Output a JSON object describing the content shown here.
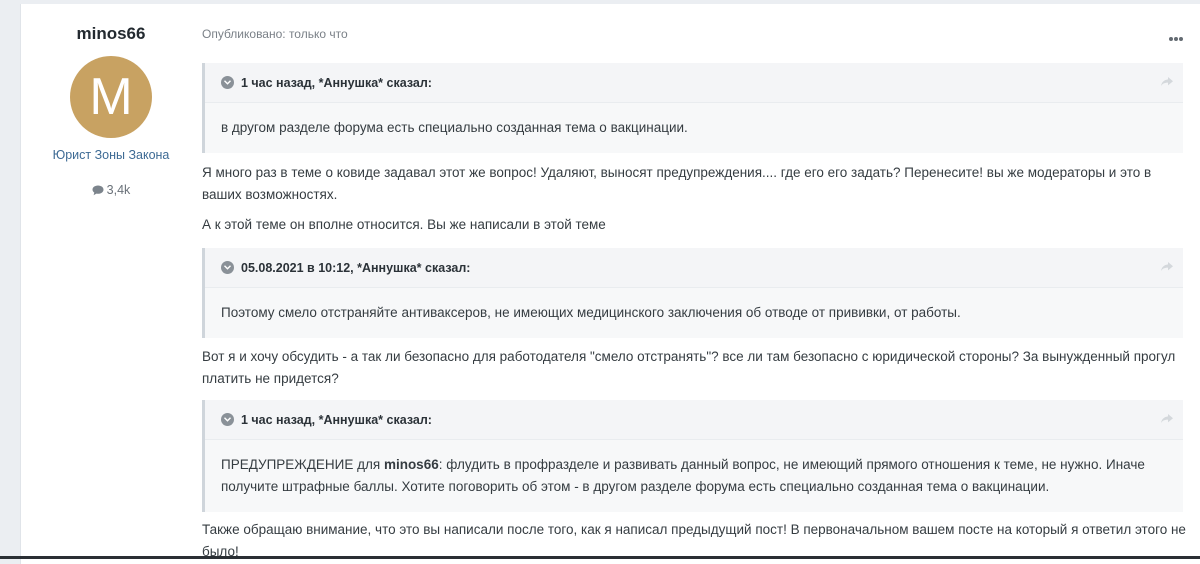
{
  "author": {
    "name": "minos66",
    "avatar_letter": "M",
    "avatar_color": "#c8a262",
    "group": "Юрист Зоны Закона",
    "posts_count": "3,4k",
    "posts_icon": "comment-icon"
  },
  "post": {
    "published": "Опубликовано: только что",
    "menu_icon": "more-horizontal-icon",
    "quote1": {
      "header": "1 час назад, *Аннушка* сказал:",
      "body": "в другом разделе форума есть специально созданная тема о вакцинации."
    },
    "para1": "Я много раз в теме о ковиде задавал этот же вопрос! Удаляют, выносят предупреждения.... где его его задать? Перенесите! вы же модераторы и это в ваших возможностях.",
    "para2": "А к этой теме он вполне относится. Вы же написали в этой теме",
    "quote2": {
      "header": "05.08.2021 в 10:12, *Аннушка* сказал:",
      "body": "Поэтому смело отстраняйте антиваксеров, не имеющих медицинского заключения об отводе от прививки, от работы."
    },
    "para3": "Вот я и хочу обсудить - а так ли безопасно для работодателя \"смело отстранять\"? все ли там безопасно с юридической стороны? За вынужденный прогул платить не придется?",
    "quote3": {
      "header": "1 час назад, *Аннушка* сказал:",
      "body_prefix": "ПРЕДУПРЕЖДЕНИЕ для ",
      "body_mention": "minos66",
      "body_suffix": ": флудить в профразделе и развивать данный вопрос, не имеющий прямого отношения к теме, не нужно. Иначе получите штрафные баллы. Хотите поговорить об этом - в другом разделе форума есть специально созданная тема о вакцинации."
    },
    "para4": "Также обращаю внимание, что это вы написали после того, как я написал предыдущий пост! В первоначальном вашем посте на который я ответил этого не было!"
  }
}
